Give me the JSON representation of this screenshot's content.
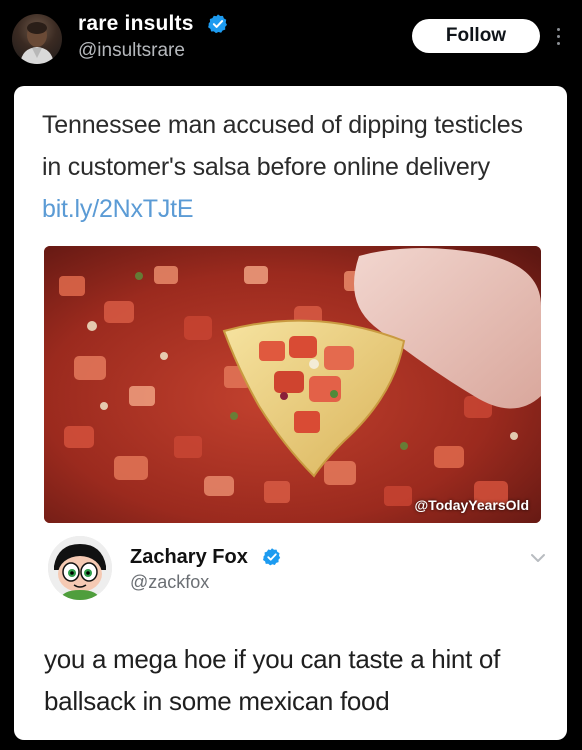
{
  "post": {
    "author_name": "rare insults",
    "author_handle": "@insultsrare",
    "follow_label": "Follow",
    "avatar_icon": "user-photo-icon",
    "verified_icon": "verified-badge-icon"
  },
  "screenshot": {
    "headline": "Tennessee man accused of dipping testicles in customer's salsa before online delivery",
    "headline_link": "bit.ly/2NxTJtE",
    "photo_watermark": "@TodayYearsOld",
    "photo_icon": "salsa-chip-photo",
    "reply": {
      "author_name": "Zachary Fox",
      "author_handle": "@zackfox",
      "avatar_icon": "cartoon-avatar-icon",
      "text": "you a mega hoe if you can taste a hint of ballsack in some mexican food"
    }
  },
  "colors": {
    "background": "#000000",
    "verified_blue": "#1d9bf0",
    "link_blue": "#5b9bd5",
    "card": "#ffffff"
  }
}
